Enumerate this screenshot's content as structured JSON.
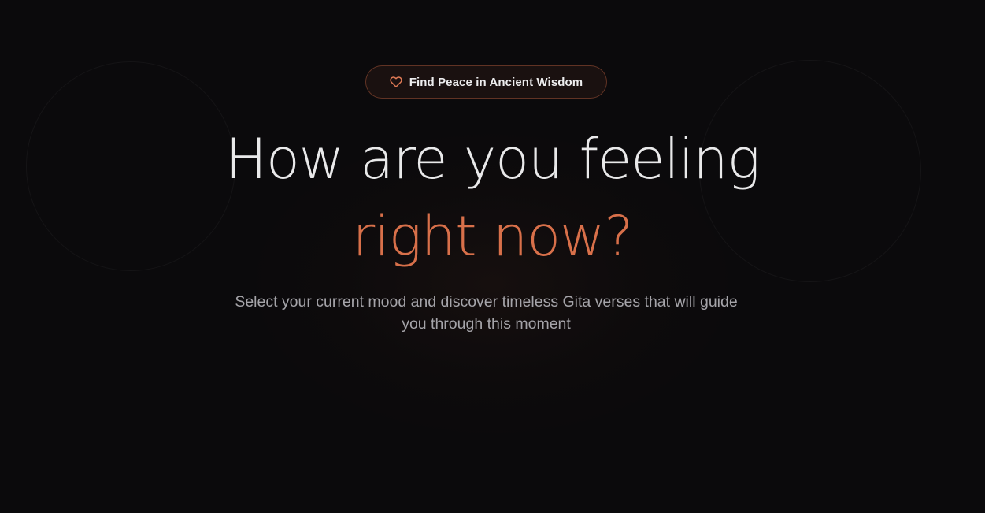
{
  "theme": {
    "background": "#0b0a0c",
    "accent": "#d8704a",
    "heading_color": "#e9e9ea",
    "subtitle_color": "#a5a4a9"
  },
  "badge": {
    "icon": "heart-icon",
    "label": "Find Peace in Ancient Wisdom"
  },
  "hero": {
    "title_line1": "How are you feeling",
    "title_line2": "right now?",
    "subtitle": "Select your current mood and discover timeless Gita verses that will guide you through this moment"
  }
}
